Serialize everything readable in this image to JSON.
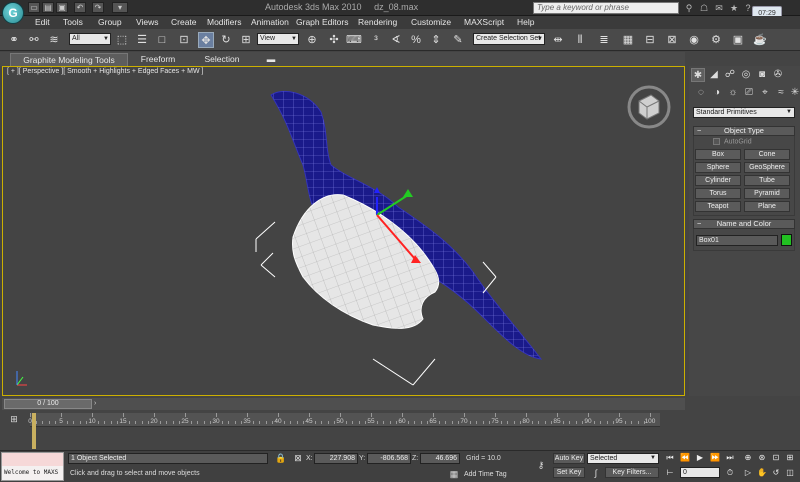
{
  "window": {
    "title": "Autodesk 3ds Max  2010",
    "filename": "dz_08.max",
    "search_placeholder": "Type a keyword or phrase",
    "clock": "07:29"
  },
  "menu": [
    "Edit",
    "Tools",
    "Group",
    "Views",
    "Create",
    "Modifiers",
    "Animation",
    "Graph Editors",
    "Rendering",
    "Customize",
    "MAXScript",
    "Help"
  ],
  "toolbar": {
    "selection_filter": "All",
    "reference_coord": "View",
    "named_selection": "Create Selection Set"
  },
  "ribbon": {
    "tabs": [
      "Graphite Modeling Tools",
      "Freeform",
      "Selection"
    ]
  },
  "viewport": {
    "label": "[ + ][ Perspective ][ Smooth + Highlights + Edged Faces + MW ]"
  },
  "command_panel": {
    "category": "Standard Primitives",
    "object_type": {
      "header": "Object Type",
      "autogrid": "AutoGrid",
      "buttons": [
        "Box",
        "Cone",
        "Sphere",
        "GeoSphere",
        "Cylinder",
        "Tube",
        "Torus",
        "Pyramid",
        "Teapot",
        "Plane"
      ]
    },
    "name_color": {
      "header": "Name and Color",
      "name": "Box01",
      "color": "#22c022"
    }
  },
  "timeline": {
    "slider": "0 / 100",
    "ticks": [
      "0",
      "5",
      "10",
      "15",
      "20",
      "25",
      "30",
      "35",
      "40",
      "45",
      "50",
      "55",
      "60",
      "65",
      "70",
      "75",
      "80",
      "85",
      "90",
      "95",
      "100"
    ]
  },
  "status": {
    "maxscript": "Welcome to MAXS",
    "selection": "1 Object Selected",
    "prompt": "Click and drag to select and move objects",
    "x_label": "X:",
    "x": "227.908",
    "y_label": "Y:",
    "y": "-806.568",
    "z_label": "Z:",
    "z": "46.696",
    "grid": "Grid = 10.0",
    "add_time_tag": "Add Time Tag",
    "auto_key": "Auto Key",
    "set_key": "Set Key",
    "key_mode": "Selected",
    "key_filters": "Key Filters...",
    "frame": "0"
  }
}
